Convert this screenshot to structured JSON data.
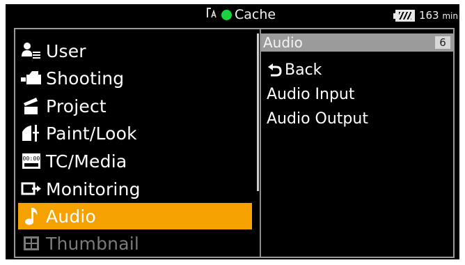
{
  "status": {
    "media_label": "Cache",
    "battery_minutes": "163",
    "battery_unit": "min",
    "rec_dot_color": "#17d33d"
  },
  "menu": {
    "items": [
      {
        "label": "User",
        "icon": "user-list-icon",
        "state": "normal"
      },
      {
        "label": "Shooting",
        "icon": "camera-icon",
        "state": "normal"
      },
      {
        "label": "Project",
        "icon": "clapperboard-icon",
        "state": "normal"
      },
      {
        "label": "Paint/Look",
        "icon": "paint-look-icon",
        "state": "normal"
      },
      {
        "label": "TC/Media",
        "icon": "timecode-icon",
        "state": "normal"
      },
      {
        "label": "Monitoring",
        "icon": "monitor-output-icon",
        "state": "normal"
      },
      {
        "label": "Audio",
        "icon": "music-note-icon",
        "state": "selected"
      },
      {
        "label": "Thumbnail",
        "icon": "thumbnail-grid-icon",
        "state": "disabled"
      }
    ],
    "selected_color": "#f5a100"
  },
  "submenu": {
    "title": "Audio",
    "count": "6",
    "items": [
      {
        "label": "Back",
        "icon": "back-arrow-icon"
      },
      {
        "label": "Audio Input"
      },
      {
        "label": "Audio Output"
      }
    ]
  }
}
